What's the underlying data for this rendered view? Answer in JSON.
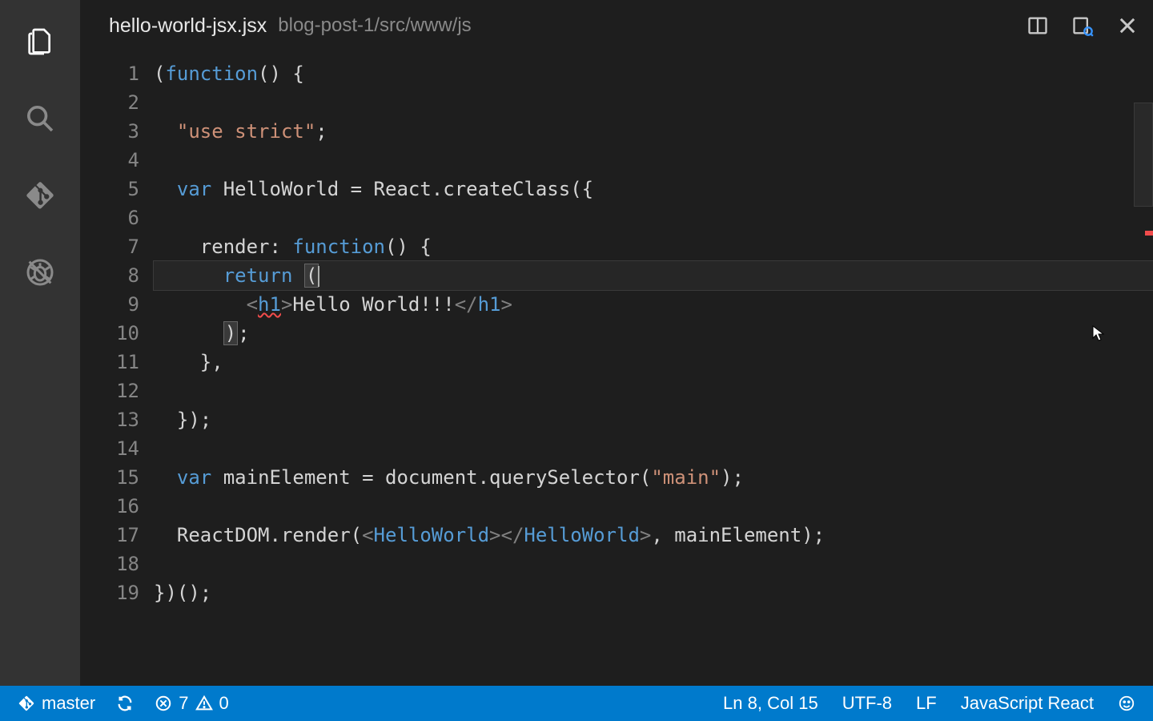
{
  "tab": {
    "filename": "hello-world-jsx.jsx",
    "path": "blog-post-1/src/www/js"
  },
  "editor": {
    "current_line": 8,
    "error_line": 9,
    "lines": [
      {
        "n": 1,
        "tokens": [
          [
            "pn",
            "("
          ],
          [
            "kw",
            "function"
          ],
          [
            "pn",
            "() {"
          ]
        ]
      },
      {
        "n": 2,
        "tokens": []
      },
      {
        "n": 3,
        "tokens": [
          [
            "pn",
            "  "
          ],
          [
            "str",
            "\"use strict\""
          ],
          [
            "pn",
            ";"
          ]
        ]
      },
      {
        "n": 4,
        "tokens": []
      },
      {
        "n": 5,
        "tokens": [
          [
            "pn",
            "  "
          ],
          [
            "kw",
            "var"
          ],
          [
            "pn",
            " HelloWorld = React.createClass({"
          ]
        ]
      },
      {
        "n": 6,
        "tokens": []
      },
      {
        "n": 7,
        "tokens": [
          [
            "pn",
            "    render: "
          ],
          [
            "kw",
            "function"
          ],
          [
            "pn",
            "() {"
          ]
        ]
      },
      {
        "n": 8,
        "tokens": [
          [
            "pn",
            "      "
          ],
          [
            "kw",
            "return"
          ],
          [
            "pn",
            " "
          ],
          [
            "match",
            "("
          ]
        ],
        "cursor_after": true
      },
      {
        "n": 9,
        "tokens": [
          [
            "pn",
            "        "
          ],
          [
            "tag",
            "<"
          ],
          [
            "tagname squiggle",
            "h1"
          ],
          [
            "tag",
            ">"
          ],
          [
            "txt",
            "Hello World!!!"
          ],
          [
            "tag",
            "</"
          ],
          [
            "tagname",
            "h1"
          ],
          [
            "tag",
            ">"
          ]
        ]
      },
      {
        "n": 10,
        "tokens": [
          [
            "pn",
            "      "
          ],
          [
            "match",
            ")"
          ],
          [
            "pn",
            ";"
          ]
        ]
      },
      {
        "n": 11,
        "tokens": [
          [
            "pn",
            "    },"
          ]
        ]
      },
      {
        "n": 12,
        "tokens": []
      },
      {
        "n": 13,
        "tokens": [
          [
            "pn",
            "  });"
          ]
        ]
      },
      {
        "n": 14,
        "tokens": []
      },
      {
        "n": 15,
        "tokens": [
          [
            "pn",
            "  "
          ],
          [
            "kw",
            "var"
          ],
          [
            "pn",
            " mainElement = document.querySelector("
          ],
          [
            "str",
            "\"main\""
          ],
          [
            "pn",
            ");"
          ]
        ]
      },
      {
        "n": 16,
        "tokens": []
      },
      {
        "n": 17,
        "tokens": [
          [
            "pn",
            "  ReactDOM.render("
          ],
          [
            "tag",
            "<"
          ],
          [
            "tagname",
            "HelloWorld"
          ],
          [
            "tag",
            ">"
          ],
          [
            "tag",
            "</"
          ],
          [
            "tagname",
            "HelloWorld"
          ],
          [
            "tag",
            ">"
          ],
          [
            "pn",
            ", mainElement);"
          ]
        ]
      },
      {
        "n": 18,
        "tokens": []
      },
      {
        "n": 19,
        "tokens": [
          [
            "pn",
            "})();"
          ]
        ]
      }
    ]
  },
  "status": {
    "branch": "master",
    "errors": "7",
    "warnings": "0",
    "position": "Ln 8, Col 15",
    "encoding": "UTF-8",
    "eol": "LF",
    "language": "JavaScript React"
  }
}
